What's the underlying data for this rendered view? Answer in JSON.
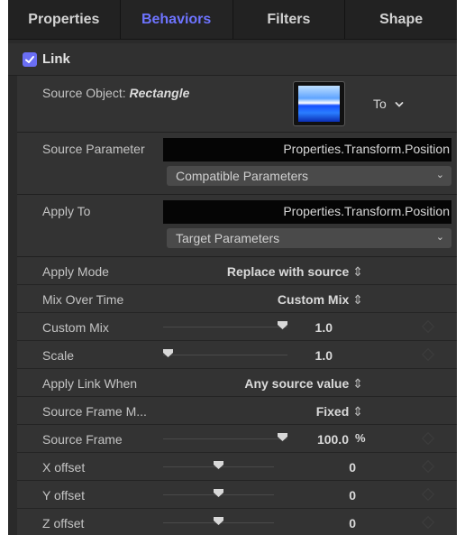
{
  "tabs": [
    {
      "label": "Properties",
      "active": false
    },
    {
      "label": "Behaviors",
      "active": true
    },
    {
      "label": "Filters",
      "active": false
    },
    {
      "label": "Shape",
      "active": false
    }
  ],
  "section": {
    "title": "Link",
    "checked": true
  },
  "source_object": {
    "label": "Source Object:",
    "value": "Rectangle",
    "to_label": "To",
    "to_icon": "chevron-down-icon"
  },
  "source_parameter": {
    "label": "Source Parameter",
    "value": "Properties.Transform.Position",
    "popup": "Compatible Parameters"
  },
  "apply_to": {
    "label": "Apply To",
    "value": "Properties.Transform.Position",
    "popup": "Target Parameters"
  },
  "apply_mode": {
    "label": "Apply Mode",
    "value": "Replace with source"
  },
  "mix_over_time": {
    "label": "Mix Over Time",
    "value": "Custom Mix"
  },
  "custom_mix": {
    "label": "Custom Mix",
    "value": "1.0",
    "level": 1.0
  },
  "scale": {
    "label": "Scale",
    "value": "1.0",
    "level": 0.0
  },
  "apply_link_when": {
    "label": "Apply Link When",
    "value": "Any source value"
  },
  "source_frame_mode": {
    "label": "Source Frame M...",
    "value": "Fixed"
  },
  "source_frame": {
    "label": "Source Frame",
    "value": "100.0",
    "unit": "%",
    "level": 1.0
  },
  "x_offset": {
    "label": "X offset",
    "value": "0",
    "level": 0.5
  },
  "y_offset": {
    "label": "Y offset",
    "value": "0",
    "level": 0.5
  },
  "z_offset": {
    "label": "Z offset",
    "value": "0",
    "level": 0.5
  },
  "colors": {
    "accent": "#6e74ff",
    "checkbox": "#6a6ef4",
    "background": "#2a2a2a",
    "field": "#050505"
  }
}
